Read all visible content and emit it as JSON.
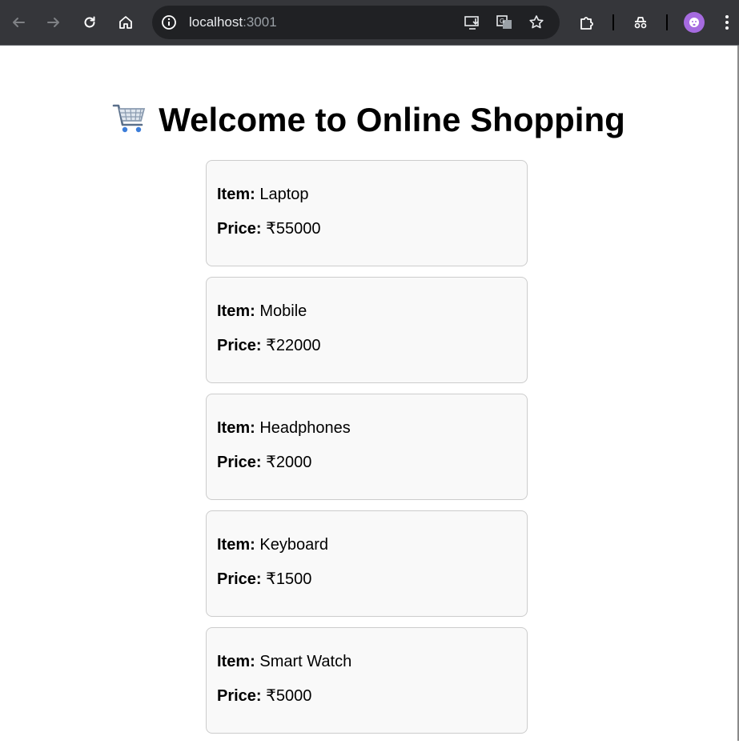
{
  "browser": {
    "url_host": "localhost",
    "url_port": ":3001",
    "icons": [
      "back-arrow-icon",
      "forward-arrow-icon",
      "reload-icon",
      "home-icon",
      "info-icon",
      "install-app-icon",
      "translate-icon",
      "bookmark-star-icon",
      "extensions-icon",
      "incognito-icon",
      "profile-avatar-icon",
      "menu-kebab-icon"
    ]
  },
  "page": {
    "title": "Welcome to Online Shopping",
    "title_icon": "shopping-cart-icon",
    "item_label": "Item:",
    "price_label": "Price:",
    "items": [
      {
        "name": "Laptop",
        "price": "₹55000"
      },
      {
        "name": "Mobile",
        "price": "₹22000"
      },
      {
        "name": "Headphones",
        "price": "₹2000"
      },
      {
        "name": "Keyboard",
        "price": "₹1500"
      },
      {
        "name": "Smart Watch",
        "price": "₹5000"
      }
    ]
  },
  "colors": {
    "toolbar": "#35363a",
    "omnibox": "#202124",
    "card_bg": "#f9f9f9",
    "card_border": "#cccccc",
    "avatar": "#a66be0"
  }
}
